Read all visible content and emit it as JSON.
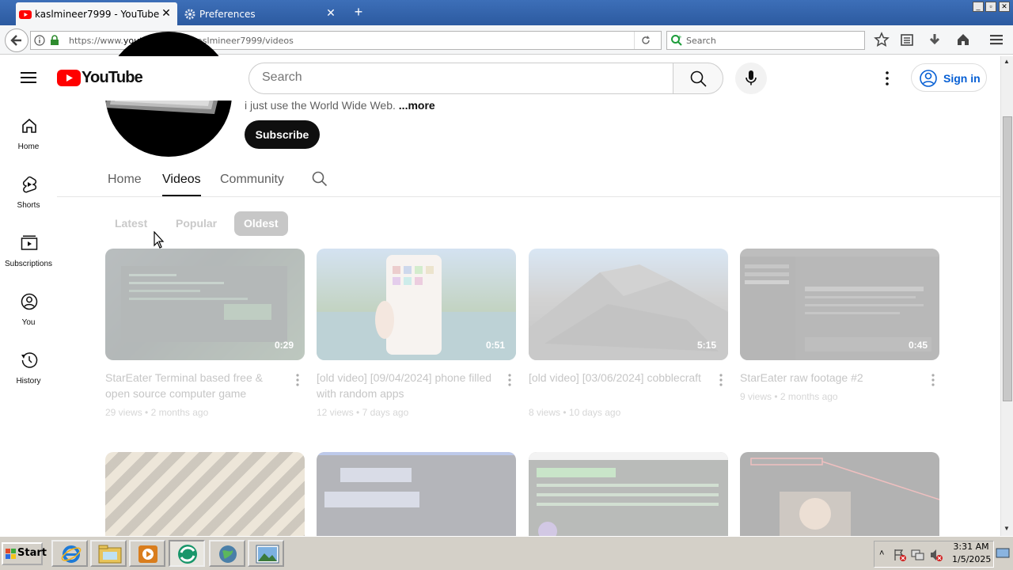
{
  "browser": {
    "tabs": [
      {
        "label": "kaslmineer7999 - YouTube"
      },
      {
        "label": "Preferences"
      }
    ],
    "url_prefix": "https://www.",
    "url_domain": "youtube.com",
    "url_path": "/@kaslmineer7999/videos",
    "search_placeholder": "Search"
  },
  "header": {
    "logo_text": "YouTube",
    "search_placeholder": "Search",
    "signin_label": "Sign in"
  },
  "rail": [
    {
      "label": "Home"
    },
    {
      "label": "Shorts"
    },
    {
      "label": "Subscriptions"
    },
    {
      "label": "You"
    },
    {
      "label": "History"
    }
  ],
  "channel": {
    "description": "i just use the World Wide Web. ",
    "more_label": "...more",
    "subscribe_label": "Subscribe",
    "tabs": [
      "Home",
      "Videos",
      "Community"
    ],
    "selected_tab": "Videos"
  },
  "chips": [
    "Latest",
    "Popular",
    "Oldest"
  ],
  "selected_chip": "Oldest",
  "videos": [
    {
      "title": "StarEater Terminal based free & open source computer game",
      "duration": "0:29",
      "views": "29 views",
      "age": "2 months ago"
    },
    {
      "title": "[old video] [09/04/2024] phone filled with random apps",
      "duration": "0:51",
      "views": "12 views",
      "age": "7 days ago"
    },
    {
      "title": "[old video] [03/06/2024] cobblecraft",
      "duration": "5:15",
      "views": "8 views",
      "age": "10 days ago"
    },
    {
      "title": "StarEater raw footage #2",
      "duration": "0:45",
      "views": "9 views",
      "age": "2 months ago"
    }
  ],
  "taskbar": {
    "start_label": "Start",
    "time": "3:31 AM",
    "date": "1/5/2025"
  },
  "colors": {
    "youtube_red": "#ff0000",
    "signin_blue": "#065fd4",
    "subscribe_bg": "#0f0f0f"
  }
}
